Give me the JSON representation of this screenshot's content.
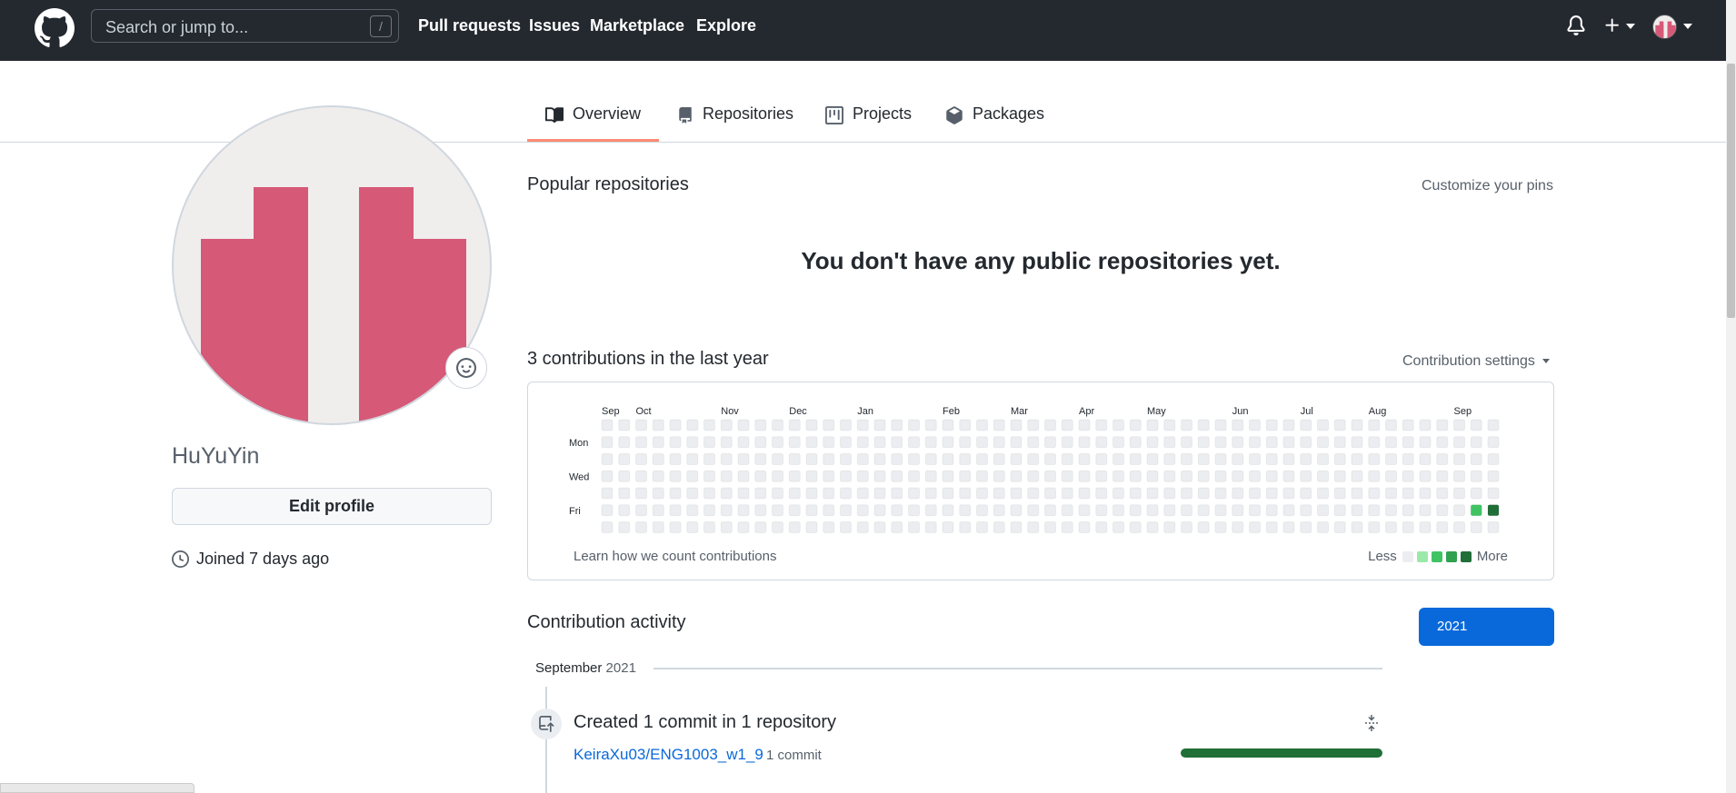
{
  "header": {
    "search_placeholder": "Search or jump to...",
    "search_shortcut": "/",
    "nav": [
      "Pull requests",
      "Issues",
      "Marketplace",
      "Explore"
    ],
    "icons": [
      "github-logo",
      "bell-icon",
      "plus-icon",
      "avatar"
    ]
  },
  "tabs": [
    {
      "label": "Overview",
      "icon": "book-icon",
      "active": true
    },
    {
      "label": "Repositories",
      "icon": "repo-icon",
      "active": false
    },
    {
      "label": "Projects",
      "icon": "project-icon",
      "active": false
    },
    {
      "label": "Packages",
      "icon": "package-icon",
      "active": false
    }
  ],
  "profile": {
    "username": "HuYuYin",
    "edit_label": "Edit profile",
    "joined": "Joined 7 days ago"
  },
  "popular": {
    "title": "Popular repositories",
    "customize": "Customize your pins",
    "empty": "You don't have any public repositories yet."
  },
  "contributions": {
    "title": "3 contributions in the last year",
    "settings": "Contribution settings",
    "months": [
      "Sep",
      "Oct",
      "Nov",
      "Dec",
      "Jan",
      "Feb",
      "Mar",
      "Apr",
      "May",
      "Jun",
      "Jul",
      "Aug",
      "Sep"
    ],
    "days": [
      "Mon",
      "Wed",
      "Fri"
    ],
    "learn": "Learn how we count contributions",
    "less": "Less",
    "more": "More",
    "colors": {
      "empty": "#ebedf0",
      "l1": "#9be9a8",
      "l2": "#40c463",
      "l3": "#30a14e",
      "l4": "#216e39"
    }
  },
  "activity": {
    "title": "Contribution activity",
    "year": "2021",
    "month": "September",
    "month_year": "2021",
    "event": "Created 1 commit in 1 repository",
    "repo": "KeiraXu03/ENG1003_w1_9",
    "commits": "1 commit",
    "progress": 1.0
  }
}
